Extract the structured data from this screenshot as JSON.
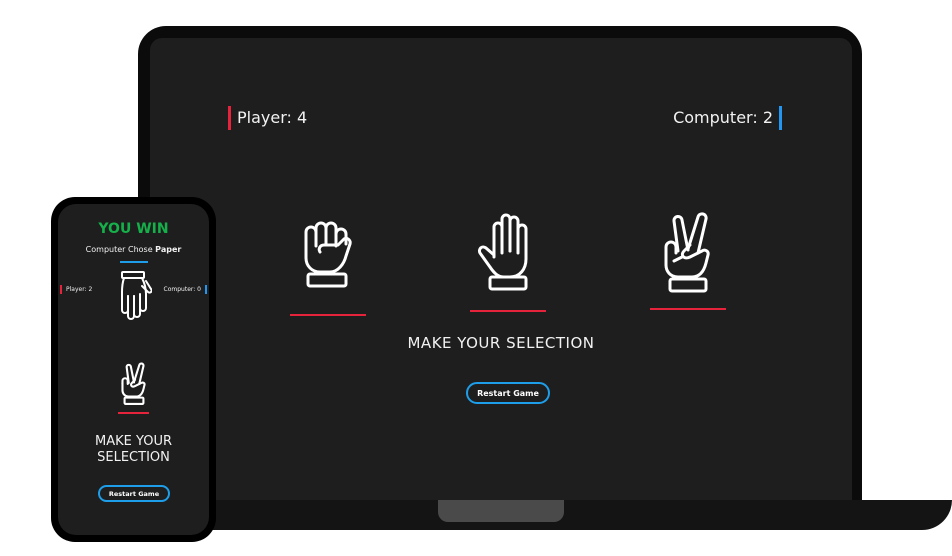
{
  "laptop": {
    "player_score_label": "Player: 4",
    "computer_score_label": "Computer: 2",
    "choices": [
      {
        "name": "Rock",
        "icon": "rock-fist-icon"
      },
      {
        "name": "Paper",
        "icon": "paper-hand-icon"
      },
      {
        "name": "Scissors",
        "icon": "scissors-peace-icon"
      }
    ],
    "prompt": "MAKE YOUR SELECTION",
    "restart_label": "Restart Game"
  },
  "phone": {
    "result": "YOU WIN",
    "computer_chose_prefix": "Computer Chose",
    "computer_choice": "Paper",
    "player_score_label": "Player: 2",
    "computer_score_label": "Computer: 0",
    "prompt_line1": "MAKE YOUR",
    "prompt_line2": "SELECTION",
    "restart_label": "Restart Game"
  },
  "colors": {
    "accent_red": "#e5243b",
    "accent_blue": "#1e9ee8",
    "win_green": "#16b04a",
    "screen_bg": "#1e1e1f"
  }
}
